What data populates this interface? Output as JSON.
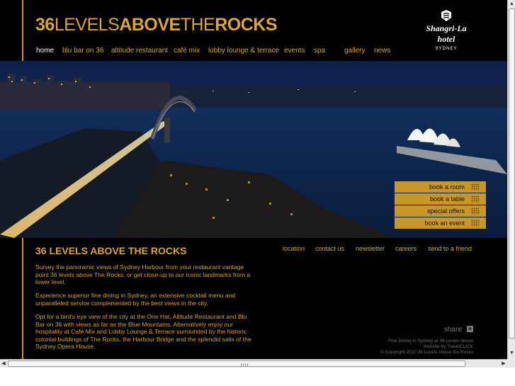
{
  "header": {
    "brand_bold_1": "36",
    "brand_light_1": "LEVELS",
    "brand_bold_2": "ABOVE",
    "brand_light_2": "THE",
    "brand_bold_3": "ROCKS",
    "hotel_name": "Shangri-La hotel",
    "hotel_city": "SYDNEY",
    "hotel_logo_icon": "shangri-la-emblem-icon"
  },
  "nav": {
    "items": [
      {
        "label": "home",
        "active": true
      },
      {
        "label": "blu bar on 36",
        "active": false
      },
      {
        "label": "altitude restaurant",
        "active": false
      },
      {
        "label": "café mix",
        "active": false
      },
      {
        "label": "lobby lounge & terrace",
        "active": false
      },
      {
        "label": "events",
        "active": false
      },
      {
        "label": "spa",
        "active": false
      },
      {
        "label": "gallery",
        "active": false
      },
      {
        "label": "news",
        "active": false
      }
    ]
  },
  "booking": {
    "items": [
      {
        "label": "book a room"
      },
      {
        "label": "book a table"
      },
      {
        "label": "special offers"
      },
      {
        "label": "book an event"
      }
    ],
    "icon": "dot-grid-icon"
  },
  "content": {
    "title": "36 LEVELS ABOVE THE ROCKS",
    "paragraphs": [
      "Survey the panoramic views of Sydney Harbour from your restaurant vantage point 36 levels above The Rocks, or get close-up to our iconic landmarks from a lower level.",
      "Experience superior fine dining in Sydney, an extensive cocktail menu and unparalleled service complemented by the best views in the city.",
      "Opt for a bird's eye view of the city at the One Hat, Altitude Restaurant and Blu Bar on 36 with views as far as the Blue Mountains. Alternatively enjoy our hospitality at Café Mix and Lobby Lounge & Terrace surrounded by the historic colonial buildings of The Rocks, the Harbour Bridge and the splendid sails of the Sydney Opera House."
    ]
  },
  "footer": {
    "links": [
      {
        "label": "location"
      },
      {
        "label": "contact us"
      },
      {
        "label": "newsletter"
      },
      {
        "label": "careers"
      },
      {
        "label": "send to a friend"
      }
    ],
    "share_label": "share",
    "share_icon": "plus-icon",
    "credits": [
      "Fine Dining in Sydney at 36 Levels Above",
      "Website by TravelCLICK",
      "© Copyright 2010 36 Levels Above the Rocks"
    ]
  },
  "colors": {
    "gold": "#d9a441",
    "button_gold": "#c8962a",
    "background": "#000000"
  }
}
